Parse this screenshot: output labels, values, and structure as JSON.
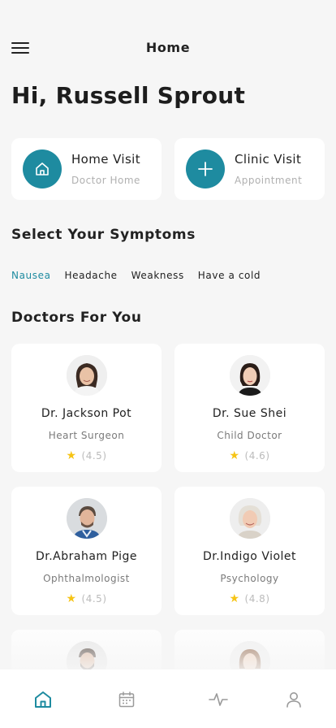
{
  "header": {
    "title": "Home",
    "menu_icon": "hamburger-menu-icon"
  },
  "greeting": "Hi, Russell Sprout",
  "visits": [
    {
      "title": "Home Visit",
      "subtitle": "Doctor Home",
      "icon": "home-icon",
      "color": "#1e8ba0"
    },
    {
      "title": "Clinic Visit",
      "subtitle": "Appointment",
      "icon": "plus-icon",
      "color": "#1e8ba0"
    }
  ],
  "symptoms": {
    "title": "Select Your Symptoms",
    "items": [
      "Nausea",
      "Headache",
      "Weakness",
      "Have a cold"
    ],
    "active": "Nausea"
  },
  "doctors": {
    "title": "Doctors For You",
    "items": [
      {
        "name": "Dr. Jackson Pot",
        "specialty": "Heart Surgeon",
        "rating": "(4.5)"
      },
      {
        "name": "Dr. Sue Shei",
        "specialty": "Child Doctor",
        "rating": "(4.6)"
      },
      {
        "name": "Dr.Abraham Pige",
        "specialty": "Ophthalmologist",
        "rating": "(4.5)"
      },
      {
        "name": "Dr.Indigo Violet",
        "specialty": "Psychology",
        "rating": "(4.8)"
      }
    ]
  },
  "bottom_nav": {
    "items": [
      "home-icon",
      "calendar-icon",
      "activity-icon",
      "profile-icon"
    ],
    "active": "home-icon"
  },
  "colors": {
    "accent": "#1e8ba0",
    "star": "#f6c415",
    "background": "#f6f6f6"
  }
}
